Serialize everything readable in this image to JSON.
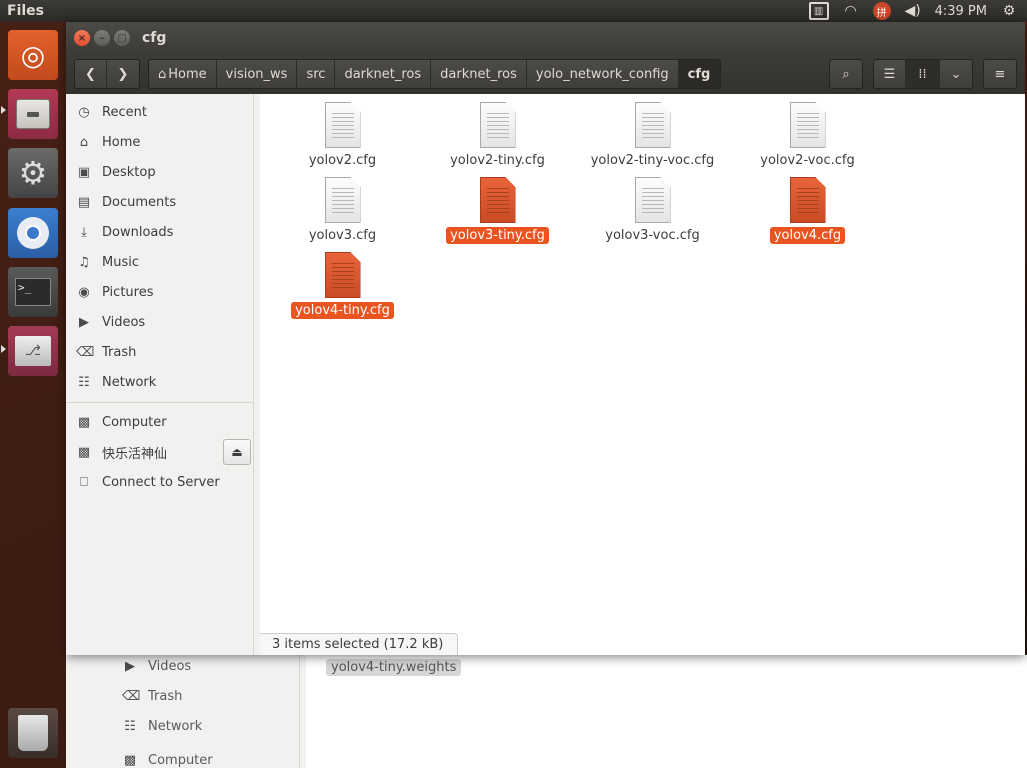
{
  "top_panel": {
    "app_title": "Files",
    "clock": "4:39 PM",
    "indicators": [
      "keyboard-indicator-icon",
      "wifi-icon",
      "input-method-icon",
      "volume-icon",
      "gear-icon"
    ]
  },
  "launcher": {
    "items": [
      "ubuntu-dash",
      "files",
      "system-settings",
      "chromium",
      "terminal",
      "usb-creator",
      "trash"
    ]
  },
  "window": {
    "title": "cfg",
    "breadcrumbs": [
      "Home",
      "vision_ws",
      "src",
      "darknet_ros",
      "darknet_ros",
      "yolo_network_config",
      "cfg"
    ],
    "active_crumb": "cfg"
  },
  "sidebar": {
    "places": [
      {
        "label": "Recent",
        "icon": "clock-icon",
        "glyph": "◷"
      },
      {
        "label": "Home",
        "icon": "home-icon",
        "glyph": "⌂"
      },
      {
        "label": "Desktop",
        "icon": "folder-icon",
        "glyph": "▣"
      },
      {
        "label": "Documents",
        "icon": "documents-icon",
        "glyph": "▤"
      },
      {
        "label": "Downloads",
        "icon": "download-icon",
        "glyph": "⤓"
      },
      {
        "label": "Music",
        "icon": "music-icon",
        "glyph": "♫"
      },
      {
        "label": "Pictures",
        "icon": "camera-icon",
        "glyph": "◉"
      },
      {
        "label": "Videos",
        "icon": "video-icon",
        "glyph": "▶"
      },
      {
        "label": "Trash",
        "icon": "trash-icon",
        "glyph": "⌫"
      },
      {
        "label": "Network",
        "icon": "network-icon",
        "glyph": "☷"
      }
    ],
    "devices": [
      {
        "label": "Computer",
        "icon": "drive-icon",
        "glyph": "▩"
      },
      {
        "label": "快乐活神仙",
        "icon": "drive-icon",
        "glyph": "▩"
      },
      {
        "label": "Connect to Server",
        "icon": "server-icon",
        "glyph": "⎕"
      }
    ]
  },
  "files": [
    {
      "name": "yolov2.cfg",
      "selected": false
    },
    {
      "name": "yolov2-tiny.cfg",
      "selected": false
    },
    {
      "name": "yolov2-tiny-voc.cfg",
      "selected": false
    },
    {
      "name": "yolov2-voc.cfg",
      "selected": false
    },
    {
      "name": "yolov3.cfg",
      "selected": false
    },
    {
      "name": "yolov3-tiny.cfg",
      "selected": true
    },
    {
      "name": "yolov3-voc.cfg",
      "selected": false
    },
    {
      "name": "yolov4.cfg",
      "selected": true
    },
    {
      "name": "yolov4-tiny.cfg",
      "selected": true
    }
  ],
  "status": "3 items selected (17.2 kB)",
  "background_window": {
    "sidebar_items": [
      {
        "label": "Videos",
        "icon": "video-icon",
        "glyph": "▶"
      },
      {
        "label": "Trash",
        "icon": "trash-icon",
        "glyph": "⌫"
      },
      {
        "label": "Network",
        "icon": "network-icon",
        "glyph": "☷"
      },
      {
        "label": "Computer",
        "icon": "drive-icon",
        "glyph": "▩"
      }
    ],
    "file": "yolov4-tiny.weights"
  },
  "colors": {
    "accent": "#e95420",
    "panel": "#3c3b37"
  }
}
